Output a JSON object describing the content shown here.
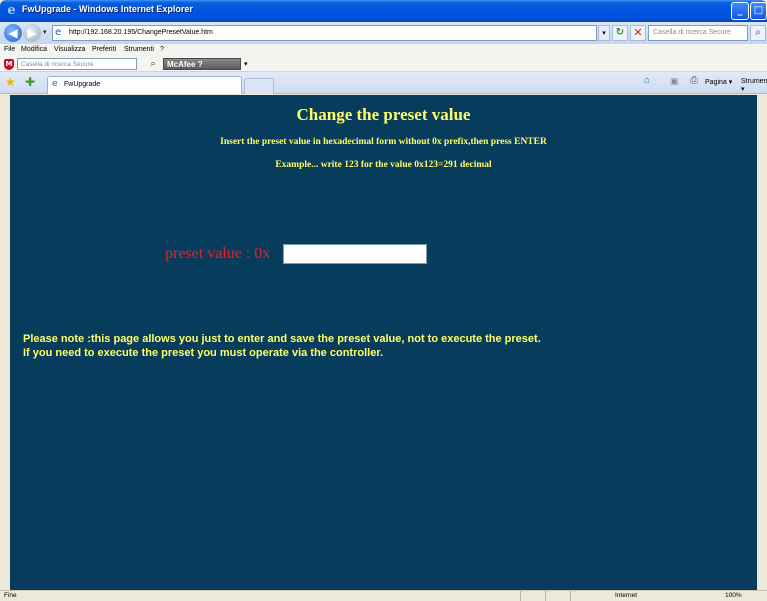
{
  "window": {
    "title": "FwUpgrade - Windows Internet Explorer",
    "min_glyph": "_",
    "max_glyph": "□"
  },
  "address": {
    "url": "http://192.168.20.195/ChangePresetValue.htm",
    "search_placeholder": "Casella di ricerca Secure"
  },
  "menu": [
    "File",
    "Modifica",
    "Visualizza",
    "Preferiti",
    "Strumenti",
    "?"
  ],
  "mcafee": {
    "search_placeholder": "Casella di ricerca Secure",
    "logo_label": "McAfee"
  },
  "tab": {
    "label": "FwUpgrade"
  },
  "commands": {
    "page": "Pagina ▾",
    "tools": "Strumenti ▾"
  },
  "page": {
    "title": "Change the preset value",
    "instruction": "Insert the preset value in hexadecimal form without 0x prefix,then press ENTER",
    "example": "Example... write 123 for the value 0x123=291 decimal",
    "preset_label": "preset value : 0x",
    "preset_value": "",
    "note_line1": "Please note :this page allows you just to enter and save the preset value, not to execute the preset.",
    "note_line2": "If you need to execute the preset you must operate via the controller."
  },
  "status": {
    "left": "Fine",
    "zone": "Internet",
    "zoom": "100%"
  },
  "colors": {
    "content_bg": "#073c5c",
    "heading_yellow": "#ffff66",
    "label_red": "#e8202a"
  }
}
